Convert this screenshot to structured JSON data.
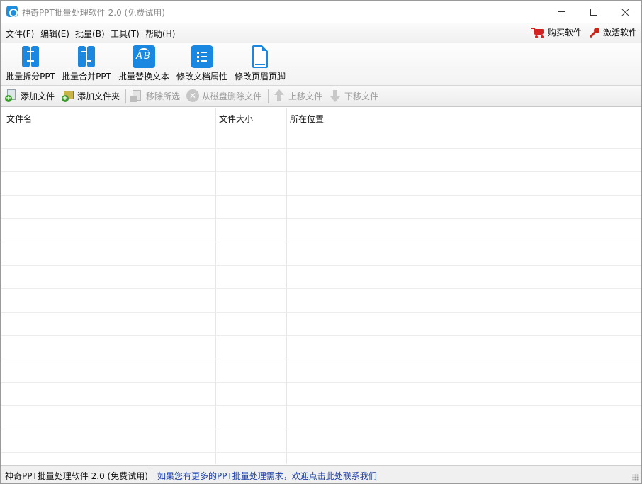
{
  "window": {
    "title": "神奇PPT批量处理软件 2.0 (免费试用)",
    "accent_color": "#1a88e0"
  },
  "menu": {
    "items": [
      {
        "label": "文件",
        "key": "F"
      },
      {
        "label": "编辑",
        "key": "E"
      },
      {
        "label": "批量",
        "key": "B"
      },
      {
        "label": "工具",
        "key": "T"
      },
      {
        "label": "帮助",
        "key": "H"
      }
    ],
    "buy_label": "购买软件",
    "activate_label": "激活软件"
  },
  "toolbar_main": {
    "items": [
      {
        "label": "批量拆分PPT",
        "icon": "split-icon"
      },
      {
        "label": "批量合并PPT",
        "icon": "merge-icon"
      },
      {
        "label": "批量替换文本",
        "icon": "replace-text-icon"
      },
      {
        "label": "修改文档属性",
        "icon": "document-properties-icon"
      },
      {
        "label": "修改页眉页脚",
        "icon": "header-footer-icon"
      }
    ]
  },
  "toolbar_files": {
    "items": [
      {
        "label": "添加文件",
        "enabled": true,
        "icon": "add-file-icon"
      },
      {
        "label": "添加文件夹",
        "enabled": true,
        "icon": "add-folder-icon"
      },
      {
        "label": "移除所选",
        "enabled": false,
        "icon": "remove-selected-icon"
      },
      {
        "label": "从磁盘删除文件",
        "enabled": false,
        "icon": "delete-from-disk-icon"
      },
      {
        "label": "上移文件",
        "enabled": false,
        "icon": "move-up-icon"
      },
      {
        "label": "下移文件",
        "enabled": false,
        "icon": "move-down-icon"
      }
    ]
  },
  "file_table": {
    "columns": [
      "文件名",
      "文件大小",
      "所在位置"
    ],
    "rows": []
  },
  "status": {
    "app_label": "神奇PPT批量处理软件 2.0 (免费试用)",
    "link_text": "如果您有更多的PPT批量处理需求，欢迎点击此处联系我们"
  }
}
